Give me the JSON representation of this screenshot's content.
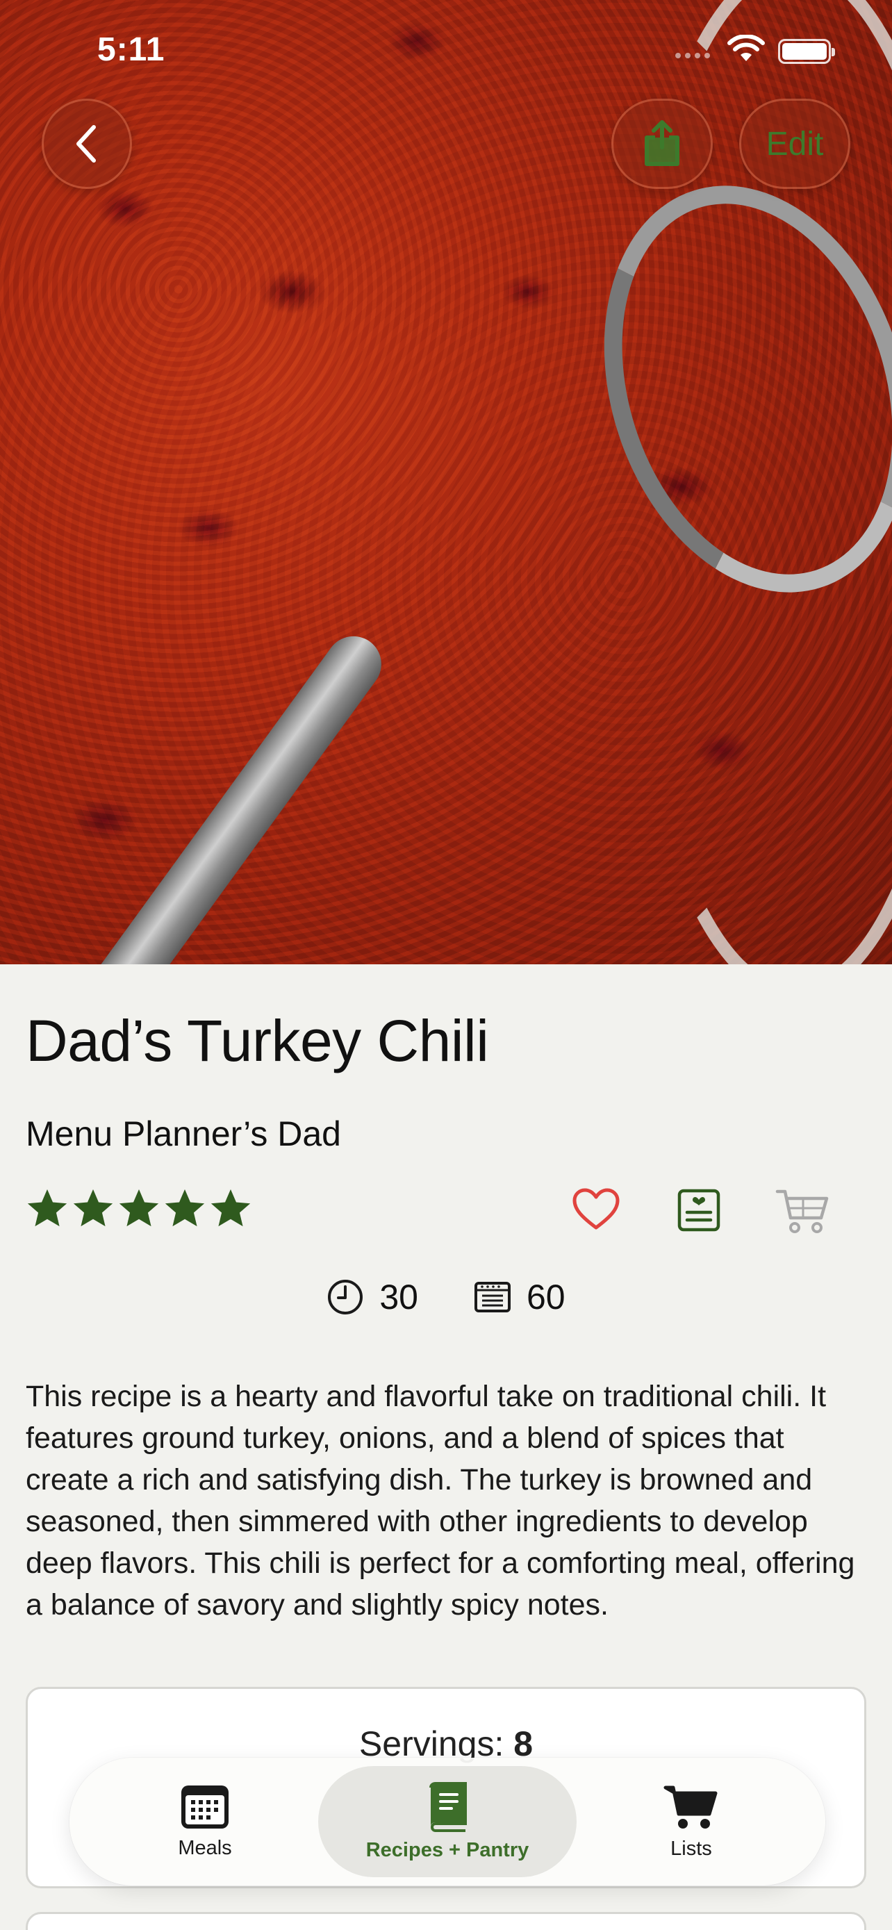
{
  "status_bar": {
    "time": "5:11"
  },
  "nav": {
    "edit_label": "Edit"
  },
  "recipe": {
    "title": "Dad’s Turkey Chili",
    "author": "Menu Planner’s Dad",
    "rating": 5,
    "prep_time": "30",
    "cook_time": "60",
    "description": "This recipe is a hearty and flavorful take on traditional chili. It features ground turkey, onions, and a blend of spices that create a rich and satisfying dish. The turkey is browned and seasoned, then simmered with other ingredients to develop deep flavors. This chili is perfect for a comforting meal, offering a balance of savory and slightly spicy notes."
  },
  "servings": {
    "label": "Servings:",
    "value": "8"
  },
  "tabbar": {
    "tabs": [
      {
        "label": "Meals",
        "icon": "calendar-icon",
        "active": false
      },
      {
        "label": "Recipes + Pantry",
        "icon": "book-icon",
        "active": true
      },
      {
        "label": "Lists",
        "icon": "cart-icon",
        "active": false
      }
    ]
  },
  "colors": {
    "accent_green": "#3d6e2a",
    "star_green": "#2f5a1e",
    "heart_red": "#e0433e",
    "background": "#f2f2ee"
  }
}
